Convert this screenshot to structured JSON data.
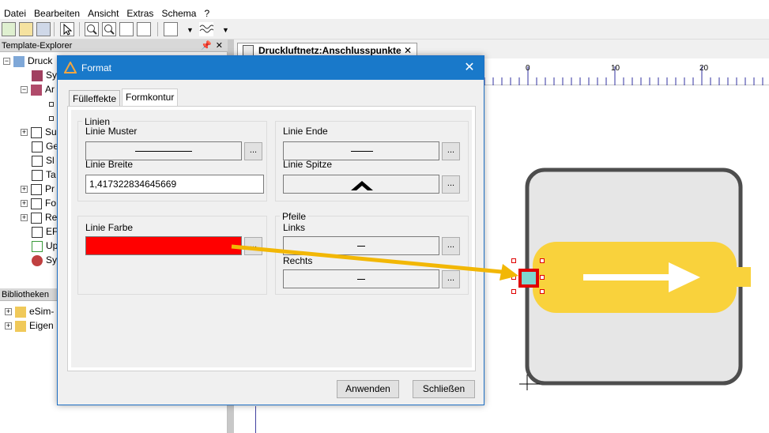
{
  "menu": [
    "Datei",
    "Bearbeiten",
    "Ansicht",
    "Extras",
    "Schema",
    "?"
  ],
  "explorer": {
    "title": "Template-Explorer",
    "items": [
      {
        "label": "Druck"
      },
      {
        "label": "Sy"
      },
      {
        "label": "Ar"
      },
      {
        "label": ""
      },
      {
        "label": ""
      },
      {
        "label": "Su"
      },
      {
        "label": "Ge"
      },
      {
        "label": "Sl"
      },
      {
        "label": "Ta"
      },
      {
        "label": "Pr"
      },
      {
        "label": "Fo"
      },
      {
        "label": "Re"
      },
      {
        "label": "EF"
      },
      {
        "label": "Up"
      },
      {
        "label": "Sy"
      }
    ]
  },
  "libraries": {
    "title": "Bibliotheken",
    "items": [
      {
        "label": "eSim-"
      },
      {
        "label": "Eigen"
      }
    ]
  },
  "document": {
    "tab_label": "Druckluftnetz:Anschlusspunkte",
    "ruler_ticks": [
      "0",
      "10",
      "20"
    ]
  },
  "dialog": {
    "title": "Format",
    "tabs": [
      "Fülleffekte",
      "Formkontur"
    ],
    "active_tab": "Formkontur",
    "lines_group": "Linien",
    "linie_muster": "Linie Muster",
    "linie_breite": "Linie Breite",
    "linie_breite_value": "1,417322834645669",
    "linie_ende": "Linie Ende",
    "linie_spitze": "Linie Spitze",
    "linie_farbe": "Linie Farbe",
    "linie_farbe_color": "#ff0000",
    "arrows_group": "Pfeile",
    "links": "Links",
    "rechts": "Rechts",
    "dots": "...",
    "apply": "Anwenden",
    "close": "Schließen"
  },
  "colors": {
    "title_bar": "#1979ca",
    "arrow": "#f2b705",
    "shape_fill": "#f9d23c",
    "box_fill": "#e6e6e6",
    "connector": "#7fd6d0"
  }
}
